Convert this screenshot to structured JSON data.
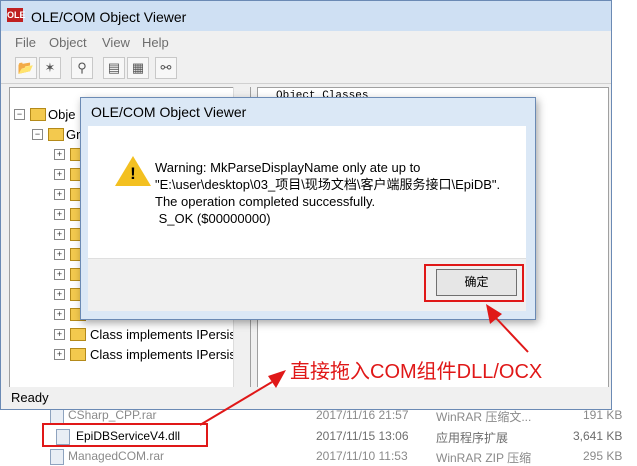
{
  "explorer": {
    "rows": [
      {
        "name": "CSharp_CPP.rar",
        "date": "2017/11/16 21:57",
        "type": "WinRAR 压缩文...",
        "size": "191 KB"
      },
      {
        "name": "EpiDBServiceV4.dll",
        "date": "2017/11/15 13:06",
        "type": "应用程序扩展",
        "size": "3,641 KB"
      },
      {
        "name": "ManagedCOM.rar",
        "date": "2017/11/10 11:53",
        "type": "WinRAR ZIP 压缩",
        "size": "295 KB"
      }
    ]
  },
  "window": {
    "title": "OLE/COM Object Viewer",
    "app_icon": "OLE"
  },
  "menu": [
    "File",
    "Object",
    "View",
    "Help"
  ],
  "toolbar": {
    "icons": [
      "open-folder-icon",
      "connect-icon",
      "tree-view-icon",
      "copy-icon",
      "idl-icon",
      "binoculars-icon"
    ]
  },
  "tree": {
    "root": "Obje",
    "group": "Gr",
    "items": [
      "",
      "",
      "",
      "",
      "",
      "",
      "",
      "",
      "",
      "Class implements IPersist",
      "Class implements IPersist"
    ]
  },
  "right_pane": {
    "header": "Object Classes"
  },
  "status": {
    "text": "Ready"
  },
  "dialog": {
    "title": "OLE/COM Object Viewer",
    "message_lines": [
      "Warning: MkParseDisplayName only ate up to",
      "\"E:\\user\\desktop\\03_项目\\现场文档\\客户端服务接口\\EpiDB\".",
      "The operation completed successfully.",
      " S_OK ($00000000)"
    ],
    "ok_label": "确定",
    "icon": "warning-icon"
  },
  "annotation": {
    "text": "直接拖入COM组件DLL/OCX",
    "color": "#e01818"
  }
}
